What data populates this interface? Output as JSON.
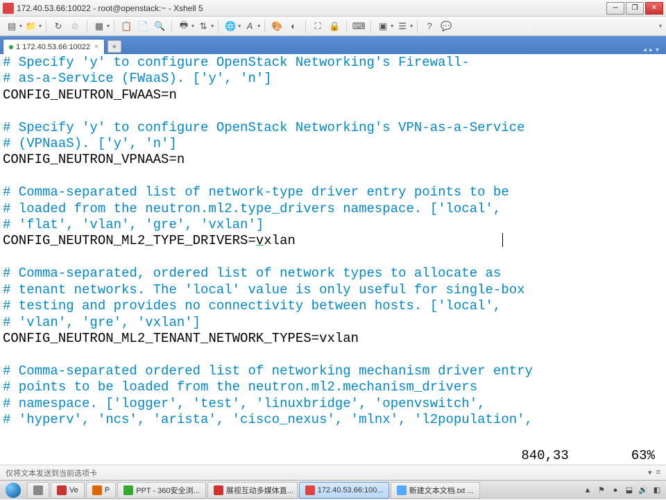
{
  "window": {
    "title": "172.40.53.66:10022 - root@openstack:~ - Xshell 5",
    "minimize": "─",
    "maximize": "❐",
    "close": "✕"
  },
  "toolbar": {
    "new": "new-session",
    "open": "open",
    "save": "save",
    "copy": "copy",
    "paste": "paste"
  },
  "tabs": {
    "active": "1 172.40.53.66:10022",
    "add": "+"
  },
  "terminal": {
    "c1": "# Specify 'y' to configure OpenStack Networking's Firewall-",
    "c2": "# as-a-Service (FWaaS). ['y', 'n']",
    "l1k": "CONFIG_NEUTRON_FWAAS=",
    "l1v": "n",
    "c3": "# Specify 'y' to configure OpenStack Networking's VPN-as-a-Service",
    "c4": "# (VPNaaS). ['y', 'n']",
    "l2k": "CONFIG_NEUTRON_VPNAAS=",
    "l2v": "n",
    "c5": "# Comma-separated list of network-type driver entry points to be",
    "c6": "# loaded from the neutron.ml2.type_drivers namespace. ['local',",
    "c7": "# 'flat', 'vlan', 'gre', 'vxlan']",
    "l3k": "CONFIG_NEUTRON_ML2_TYPE_DRIVERS=",
    "l3v": "v",
    "l3v2": "xlan",
    "c8": "# Comma-separated, ordered list of network types to allocate as",
    "c9": "# tenant networks. The 'local' value is only useful for single-box",
    "c10": "# testing and provides no connectivity between hosts. ['local',",
    "c11": "# 'vlan', 'gre', 'vxlan']",
    "l4k": "CONFIG_NEUTRON_ML2_TENANT_NETWORK_TYPES=",
    "l4v": "vxlan",
    "c12": "# Comma-separated ordered list of networking mechanism driver entry",
    "c13": "# points to be loaded from the neutron.ml2.mechanism_drivers",
    "c14": "# namespace. ['logger', 'test', 'linuxbridge', 'openvswitch',",
    "c15": "# 'hyperv', 'ncs', 'arista', 'cisco_nexus', 'mlnx', 'l2population',",
    "position": "840,33",
    "percent": "63%"
  },
  "statusbar": {
    "text": "仅将文本发送到当前选项卡"
  },
  "taskbar": {
    "items": [
      {
        "label": "",
        "color": "#888"
      },
      {
        "label": "Ve",
        "color": "#c33"
      },
      {
        "label": "P",
        "color": "#d60"
      },
      {
        "label": "PPT - 360安全浏...",
        "color": "#3a3"
      },
      {
        "label": "展视互动多媒体直...",
        "color": "#c33"
      },
      {
        "label": "172.40.53.66:100...",
        "color": "#d44",
        "active": true
      },
      {
        "label": "新建文本文档.txt ...",
        "color": "#5af"
      }
    ],
    "time": "",
    "arrow": "▲"
  }
}
